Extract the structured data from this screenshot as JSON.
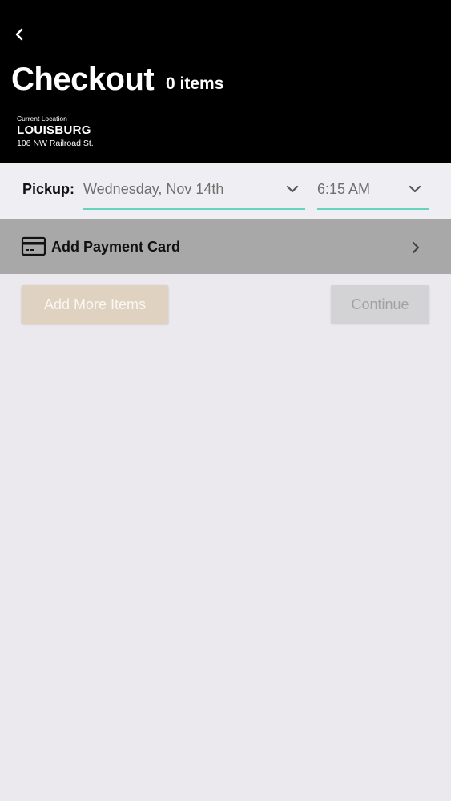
{
  "header": {
    "back_icon": "chevron-left-icon",
    "title": "Checkout",
    "item_count": "0 items",
    "location_label": "Current Location",
    "location_name": "LOUISBURG",
    "location_address": "106 NW Railroad St."
  },
  "pickup": {
    "label": "Pickup:",
    "date_value": "Wednesday, Nov 14th",
    "time_value": "6:15 AM",
    "dropdown_icon": "chevron-down-icon",
    "accent_color": "#64d3bf"
  },
  "payment": {
    "icon": "credit-card-icon",
    "label": "Add Payment Card",
    "arrow_icon": "chevron-right-icon"
  },
  "actions": {
    "add_more_label": "Add More Items",
    "continue_label": "Continue"
  }
}
